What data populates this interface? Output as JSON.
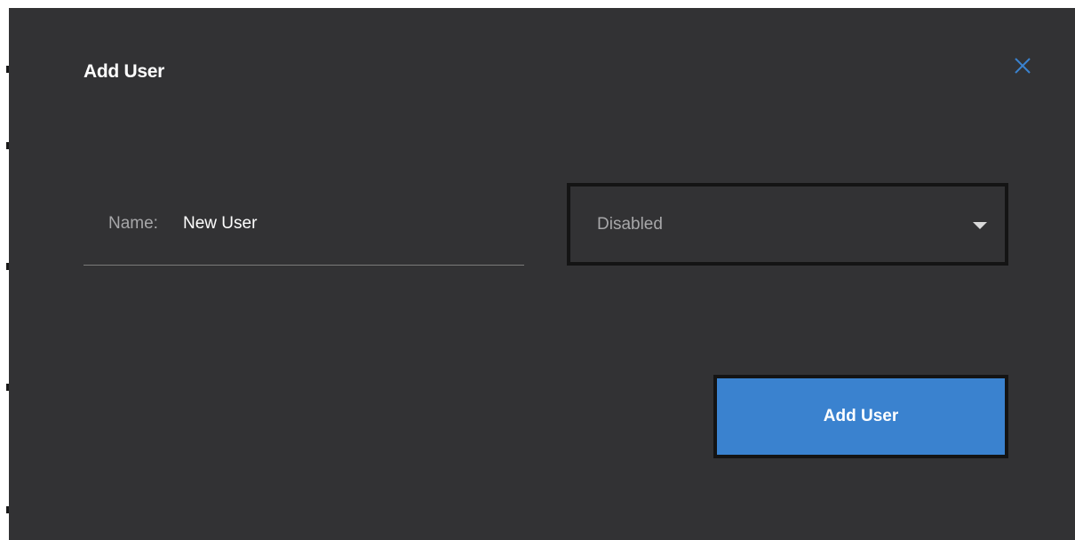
{
  "dialog": {
    "title": "Add User",
    "close_icon": "close-icon",
    "name_field": {
      "label": "Name:",
      "value": "New User"
    },
    "status_select": {
      "selected": "Disabled",
      "caret_icon": "chevron-down-icon"
    },
    "add_button_label": "Add User"
  },
  "colors": {
    "background": "#323234",
    "accent": "#3a82cf",
    "close_icon": "#3a82cf",
    "border_dark": "#141414",
    "label_gray": "#a7a7a9",
    "text_white": "#ffffff"
  }
}
